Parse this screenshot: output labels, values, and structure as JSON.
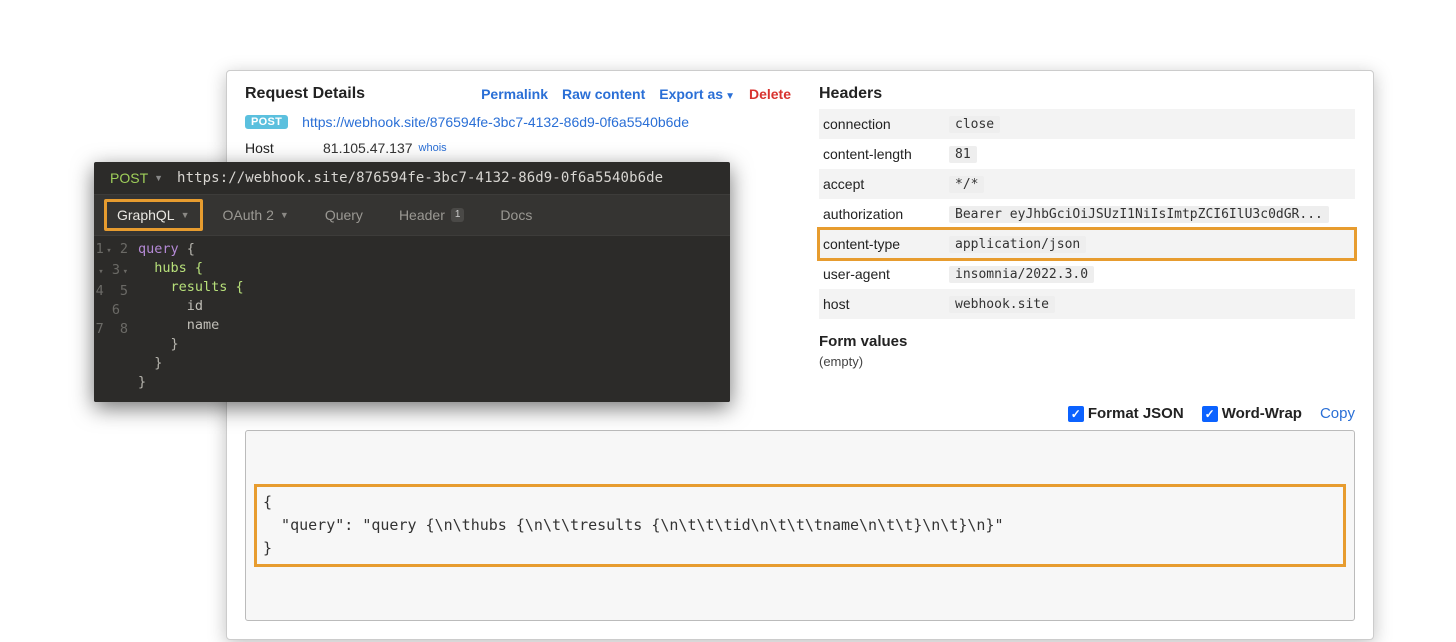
{
  "details": {
    "title": "Request Details",
    "actions": {
      "permalink": "Permalink",
      "raw": "Raw content",
      "export": "Export as",
      "delete": "Delete"
    },
    "method_badge": "POST",
    "url": "https://webhook.site/876594fe-3bc7-4132-86d9-0f6a5540b6de",
    "host_label": "Host",
    "host_value": "81.105.47.137",
    "whois": "whois"
  },
  "headers": {
    "title": "Headers",
    "rows": [
      {
        "name": "connection",
        "value": "close"
      },
      {
        "name": "content-length",
        "value": "81"
      },
      {
        "name": "accept",
        "value": "*/*"
      },
      {
        "name": "authorization",
        "value": "Bearer eyJhbGciOiJSUzI1NiIsImtpZCI6IlU3c0dGR..."
      },
      {
        "name": "content-type",
        "value": "application/json"
      },
      {
        "name": "user-agent",
        "value": "insomnia/2022.3.0"
      },
      {
        "name": "host",
        "value": "webhook.site"
      }
    ]
  },
  "formvalues": {
    "title": "Form values",
    "empty": "(empty)"
  },
  "options": {
    "format_json": "Format JSON",
    "word_wrap": "Word-Wrap",
    "copy": "Copy"
  },
  "body": {
    "line1": "{",
    "line2": "  \"query\": \"query {\\n\\thubs {\\n\\t\\tresults {\\n\\t\\t\\tid\\n\\t\\t\\tname\\n\\t\\t}\\n\\t}\\n}\"",
    "line3": "}"
  },
  "insomnia": {
    "method": "POST",
    "url": "https://webhook.site/876594fe-3bc7-4132-86d9-0f6a5540b6de",
    "tabs": {
      "graphql": "GraphQL",
      "oauth": "OAuth 2",
      "query": "Query",
      "header": "Header",
      "header_count": "1",
      "docs": "Docs"
    },
    "code": {
      "l1_kw": "query",
      "l1_brace": " {",
      "l2": "  hubs {",
      "l3": "    results {",
      "l4": "      id",
      "l5": "      name",
      "l6": "    }",
      "l7": "  }",
      "l8": "}",
      "gutter": [
        "1",
        "2",
        "3",
        "4",
        "5",
        "6",
        "7",
        "8"
      ]
    }
  }
}
